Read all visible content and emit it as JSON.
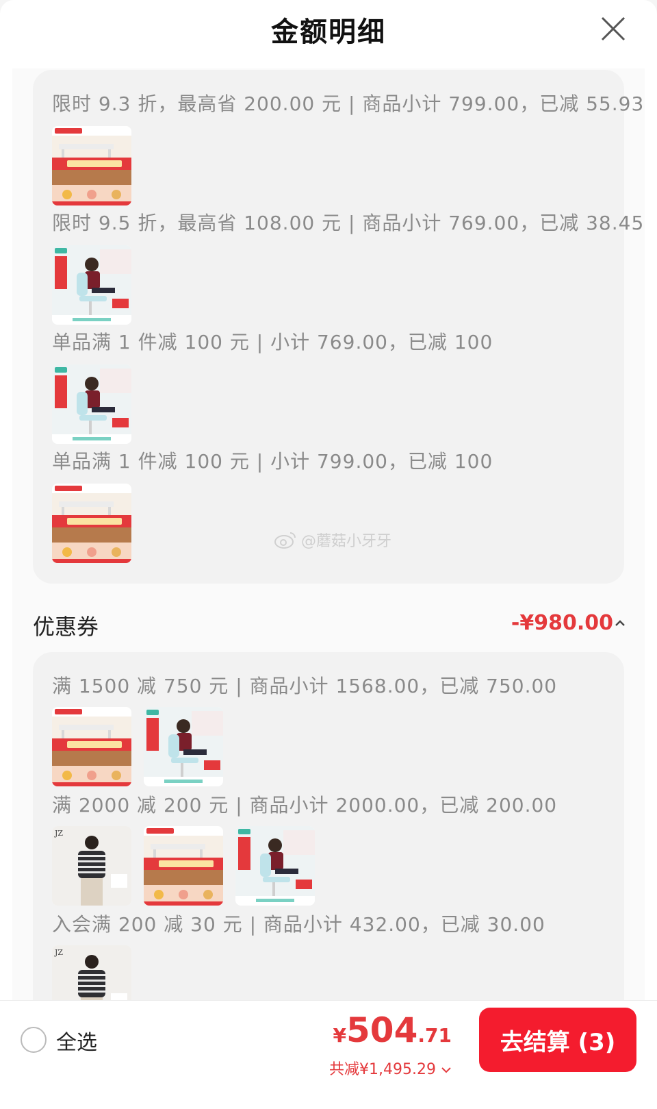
{
  "header": {
    "title": "金额明细"
  },
  "promotions": [
    {
      "text": "限时 9.3 折，最高省 200.00 元 | 商品小计 799.00，已减 55.93",
      "thumbs": [
        "desk"
      ]
    },
    {
      "text": "限时 9.5 折，最高省 108.00 元 | 商品小计 769.00，已减 38.45",
      "thumbs": [
        "chair"
      ]
    },
    {
      "text": "单品满 1 件减 100 元 | 小计 769.00，已减 100",
      "thumbs": [
        "chair"
      ]
    },
    {
      "text": "单品满 1 件减 100 元 | 小计 799.00，已减 100",
      "thumbs": [
        "desk"
      ]
    }
  ],
  "watermark": "@蘑菇小牙牙",
  "coupon_section": {
    "title": "优惠券",
    "amount": "-¥980.00"
  },
  "coupons": [
    {
      "text": "满 1500 减 750 元 | 商品小计 1568.00，已减 750.00",
      "thumbs": [
        "desk",
        "chair"
      ]
    },
    {
      "text": "满 2000 减 200 元 | 商品小计 2000.00，已减 200.00",
      "thumbs": [
        "sweater",
        "desk",
        "chair"
      ]
    },
    {
      "text": "入会满 200 减 30 元 | 商品小计 432.00，已减 30.00",
      "thumbs": [
        "sweater"
      ]
    }
  ],
  "footer": {
    "select_all": "全选",
    "currency": "¥",
    "price_int": "504",
    "price_dec": ".71",
    "saved": "共减¥1,495.29",
    "checkout": "去结算 (3)"
  },
  "colors": {
    "accent": "#f41c2e",
    "price": "#e4393c",
    "muted": "#8a8a8a"
  },
  "icons": [
    "close-icon",
    "chevron-up-icon",
    "chevron-down-icon",
    "weibo-icon"
  ]
}
